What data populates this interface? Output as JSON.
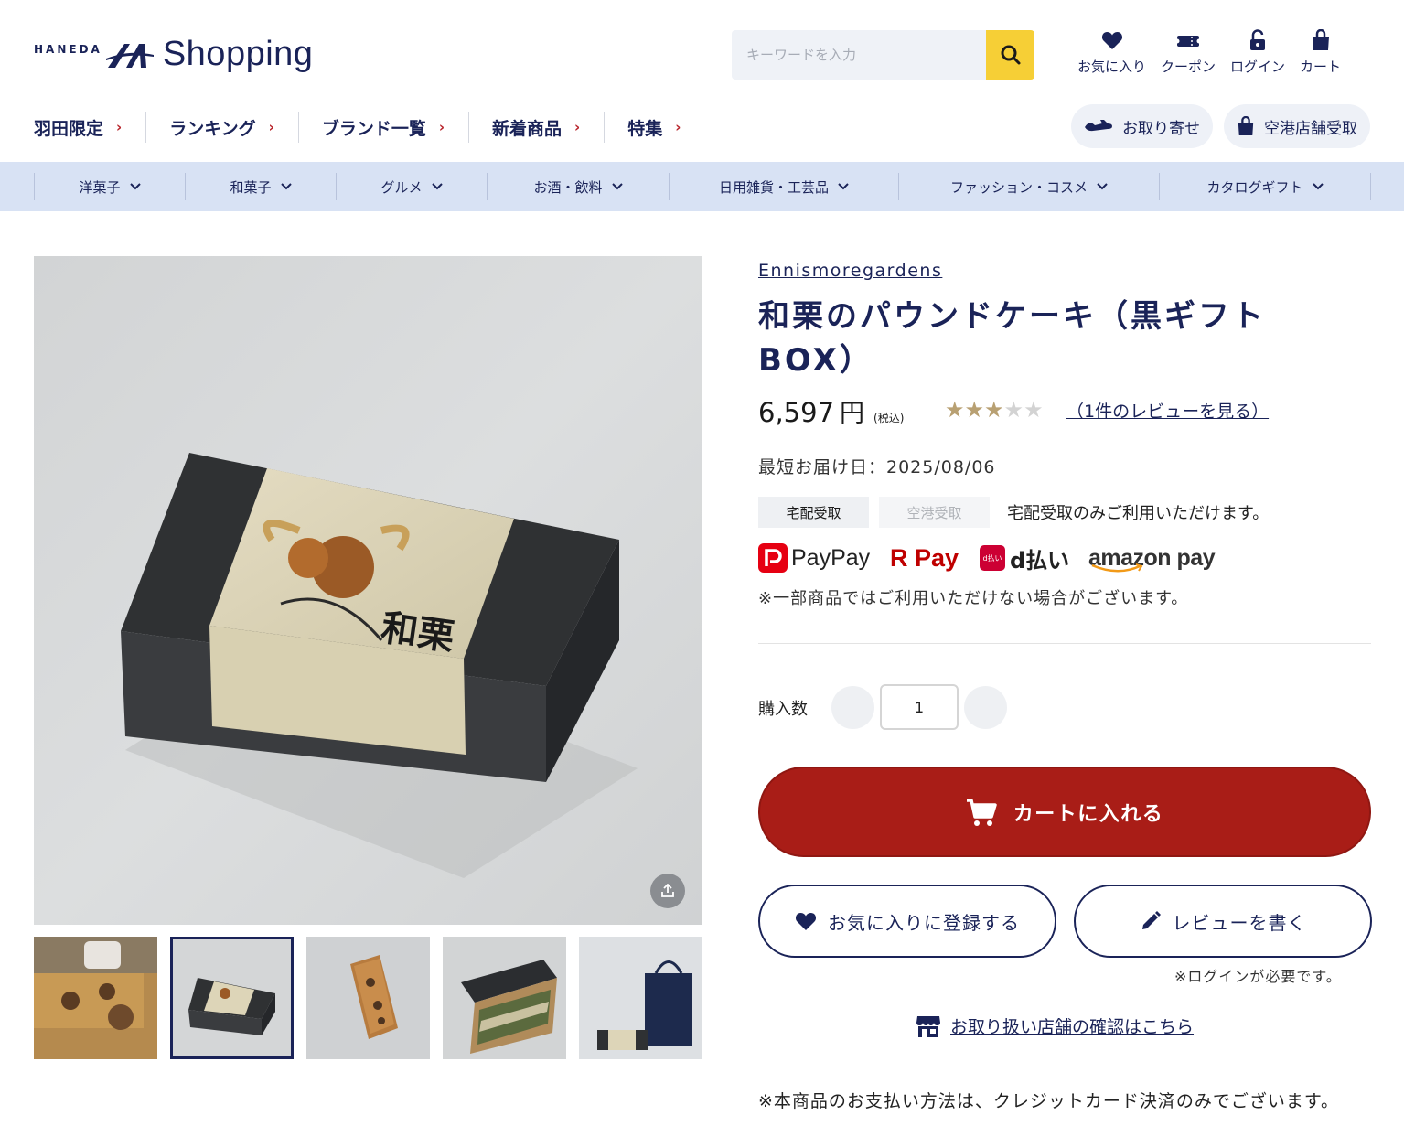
{
  "header": {
    "logo_small": "HANEDA",
    "logo_text": "Shopping",
    "search_placeholder": "キーワードを入力",
    "icons": [
      {
        "label": "お気に入り",
        "icon": "heart-icon"
      },
      {
        "label": "クーポン",
        "icon": "coupon-icon"
      },
      {
        "label": "ログイン",
        "icon": "lock-icon"
      },
      {
        "label": "カート",
        "icon": "bag-icon"
      }
    ]
  },
  "mainnav": {
    "items": [
      "羽田限定",
      "ランキング",
      "ブランド一覧",
      "新着商品",
      "特集"
    ],
    "pill_delivery": "お取り寄せ",
    "pill_airport": "空港店舗受取"
  },
  "categories": [
    "洋菓子",
    "和菓子",
    "グルメ",
    "お酒・飲料",
    "日用雑貨・工芸品",
    "ファッション・コスメ",
    "カタログギフト"
  ],
  "product": {
    "brand": "Ennismoregardens",
    "title_line1": "和栗のパウンドケーキ（黒ギフト",
    "title_line2": "BOX）",
    "price": "6,597",
    "price_unit": "円",
    "tax_label": "(税込)",
    "rating": 3,
    "rating_max": 5,
    "review_link": "（1件のレビューを見る）",
    "delivery_date": "最短お届け日：2025/08/06",
    "box_label": "和栗",
    "tag_home": "宅配受取",
    "tag_airport": "空港受取",
    "tag_note": "宅配受取のみご利用いただけます。",
    "payments": [
      "PayPay",
      "R Pay",
      "d払い",
      "amazon pay"
    ],
    "payments_small": "d払い",
    "payment_note": "※一部商品ではご利用いただけない場合がございます。",
    "qty_label": "購入数",
    "qty_value": "1",
    "cart_button": "カートに入れる",
    "favorite_button": "お気に入りに登録する",
    "review_button": "レビューを書く",
    "login_note": "※ログインが必要です。",
    "store_link": "お取り扱い店舗の確認はこちら",
    "payment_method_note": "※本商品のお支払い方法は、クレジットカード決済のみでございます。"
  },
  "colors": {
    "navy": "#1a2358",
    "accent_red": "#a91d17",
    "search_yellow": "#f6cf36",
    "category_bar": "#d8e2f4",
    "star_on": "#b8a072"
  }
}
